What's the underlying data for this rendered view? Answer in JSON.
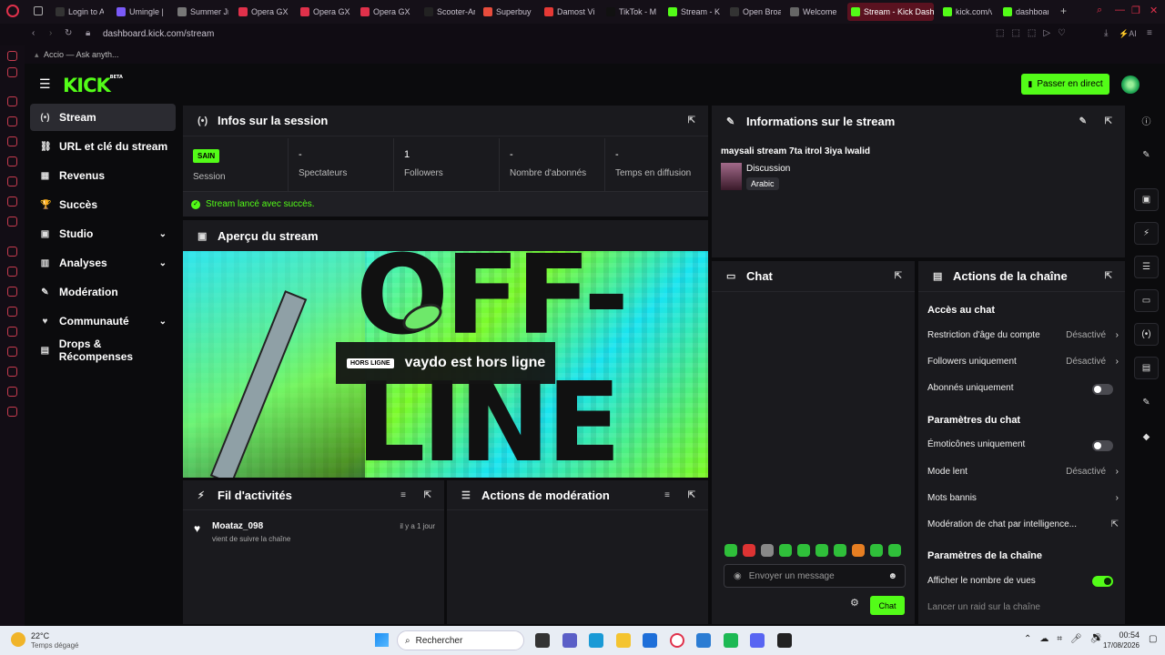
{
  "browser": {
    "tabs": [
      "Login to Ac",
      "Umingle | ",
      "Summer Jr",
      "Opera GX",
      "Opera GX",
      "Opera GX",
      "Scooter-Ar",
      "Superbuy",
      "Damost Vi",
      "TikTok - M",
      "Stream - K",
      "Open Broa",
      "Welcome | ",
      "Stream - Kick Dash",
      "kick.com/v",
      "dashboard"
    ],
    "url": "dashboard.kick.com/stream",
    "bookmark": "Accio — Ask anyth..."
  },
  "header": {
    "logo": "KICK",
    "logo_sup": "BETA",
    "go_live": "Passer en direct"
  },
  "nav": [
    {
      "label": "Stream",
      "icon": "(•)"
    },
    {
      "label": "URL et clé du stream",
      "icon": "⛓"
    },
    {
      "label": "Revenus",
      "icon": "▦"
    },
    {
      "label": "Succès",
      "icon": "🏆"
    },
    {
      "label": "Studio",
      "icon": "▣"
    },
    {
      "label": "Analyses",
      "icon": "▥"
    },
    {
      "label": "Modération",
      "icon": "✎"
    },
    {
      "label": "Communauté",
      "icon": "♥"
    },
    {
      "label": "Drops & Récompenses",
      "icon": "▤"
    }
  ],
  "session": {
    "title": "Infos sur la session",
    "health_badge": "SAIN",
    "stats": [
      {
        "value": "",
        "label": "Session"
      },
      {
        "value": "-",
        "label": "Spectateurs"
      },
      {
        "value": "1",
        "label": "Followers"
      },
      {
        "value": "-",
        "label": "Nombre d'abonnés"
      },
      {
        "value": "-",
        "label": "Temps en diffusion"
      }
    ],
    "status": "Stream lancé avec succès."
  },
  "preview": {
    "title": "Aperçu du stream",
    "offline_badge": "HORS LIGNE",
    "offline_text": "vaydo est hors ligne",
    "bg_text_1": "OFF-",
    "bg_text_2": "LINE"
  },
  "activity": {
    "title": "Fil d'activités",
    "user": "Moataz_098",
    "time": "il y a 1 jour",
    "desc": "vient de suivre la chaîne"
  },
  "modactions": {
    "title": "Actions de modération"
  },
  "streaminfo": {
    "title": "Informations sur le stream",
    "stream_title": "maysali stream 7ta itrol 3iya lwalid",
    "category": "Discussion",
    "language": "Arabic"
  },
  "chat": {
    "title": "Chat",
    "placeholder": "Envoyer un message",
    "send": "Chat"
  },
  "channel_actions": {
    "title": "Actions de la chaîne",
    "sec_chat_access": "Accès au chat",
    "age_restriction": "Restriction d'âge du compte",
    "age_val": "Désactivé",
    "followers_only": "Followers uniquement",
    "followers_val": "Désactivé",
    "subs_only": "Abonnés uniquement",
    "sec_chat_params": "Paramètres du chat",
    "emotes_only": "Émoticônes uniquement",
    "slow_mode": "Mode lent",
    "slow_val": "Désactivé",
    "banned_words": "Mots bannis",
    "ai_moderation": "Modération de chat par intelligence...",
    "sec_channel_params": "Paramètres de la chaîne",
    "show_views": "Afficher le nombre de vues",
    "raid": "Lancer un raid sur la chaîne"
  },
  "taskbar": {
    "temp": "22°C",
    "weather": "Temps dégagé",
    "search": "Rechercher",
    "time": "00:54",
    "date": "17/08/2026"
  },
  "colors": {
    "accent": "#53fc18",
    "panel": "#1a1a1e",
    "bg": "#0b0b0d"
  }
}
